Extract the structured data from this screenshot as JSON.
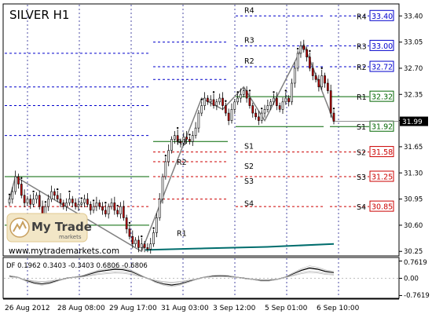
{
  "header": {
    "title": "SILVER H1"
  },
  "watermark": {
    "brand": "My Trade",
    "sub": "markets",
    "url": "www.mytrademarkets.com"
  },
  "colors": {
    "candle_up": "#ffffff",
    "candle_down": "#c00000",
    "wick": "#000000",
    "level_blue": "#0000cc",
    "level_red": "#cc0000",
    "level_green": "#006600",
    "zigzag": "#808080",
    "ma_teal": "#006d6d",
    "current_price_bg": "#000000"
  },
  "chart_data": [
    {
      "type": "candlestick",
      "title": "SILVER H1",
      "x_tick_labels": [
        "26 Aug 2012",
        "28 Aug 08:00",
        "29 Aug 17:00",
        "31 Aug 03:00",
        "3 Sep 12:00",
        "5 Sep 01:00",
        "6 Sep 10:00"
      ],
      "y_tick_labels": [
        "33.40",
        "33.05",
        "32.70",
        "32.35",
        "32.00",
        "31.65",
        "31.30",
        "30.95",
        "30.60",
        "30.25"
      ],
      "ylim": [
        30.2,
        33.55
      ],
      "current_price": "31.99",
      "close_series": [
        30.95,
        31.05,
        31.25,
        31.15,
        31.0,
        30.9,
        30.95,
        30.88,
        30.95,
        31.0,
        30.85,
        30.75,
        30.85,
        30.95,
        31.05,
        31.0,
        30.95,
        30.9,
        30.85,
        30.9,
        30.95,
        30.9,
        30.85,
        30.88,
        30.9,
        30.95,
        30.88,
        30.8,
        30.85,
        30.9,
        30.85,
        30.8,
        30.75,
        30.85,
        30.9,
        30.8,
        30.75,
        30.85,
        30.7,
        30.55,
        30.45,
        30.35,
        30.4,
        30.3,
        30.35,
        30.3,
        30.28,
        30.35,
        30.5,
        30.7,
        30.95,
        31.25,
        31.45,
        31.6,
        31.75,
        31.8,
        31.72,
        31.7,
        31.78,
        31.75,
        31.72,
        31.8,
        31.9,
        32.1,
        32.2,
        32.3,
        32.25,
        32.28,
        32.2,
        32.25,
        32.3,
        32.2,
        32.1,
        32.0,
        32.15,
        32.25,
        32.3,
        32.35,
        32.4,
        32.3,
        32.2,
        32.1,
        32.05,
        32.0,
        32.1,
        32.15,
        32.2,
        32.25,
        32.3,
        32.2,
        32.15,
        32.25,
        32.3,
        32.25,
        32.5,
        32.7,
        32.9,
        33.0,
        32.95,
        32.85,
        32.7,
        32.6,
        32.55,
        32.45,
        32.6,
        32.5,
        32.4,
        32.1,
        31.99
      ],
      "zigzag": [
        [
          0,
          30.95
        ],
        [
          2,
          31.25
        ],
        [
          44,
          30.25
        ],
        [
          64,
          32.3
        ],
        [
          71,
          32.15
        ],
        [
          78,
          32.45
        ],
        [
          85,
          32.0
        ],
        [
          98,
          33.02
        ],
        [
          108,
          31.99
        ]
      ],
      "pivot_levels": [
        {
          "name": "R4",
          "group": "previous",
          "value": 33.4,
          "color": "blue"
        },
        {
          "name": "R3",
          "group": "previous",
          "value": 33.0,
          "color": "blue"
        },
        {
          "name": "R2",
          "group": "previous",
          "value": 32.72,
          "color": "blue"
        },
        {
          "name": "R1",
          "group": "previous",
          "value": 32.32,
          "color": "green"
        },
        {
          "name": "S1",
          "group": "previous",
          "value": 31.92,
          "color": "green"
        },
        {
          "name": "S2",
          "group": "previous",
          "value": 31.58,
          "color": "red"
        },
        {
          "name": "S3",
          "group": "previous",
          "value": 31.25,
          "color": "red"
        },
        {
          "name": "S4",
          "group": "previous",
          "value": 30.85,
          "color": "red"
        }
      ],
      "right_level_labels": [
        {
          "label": "R4",
          "price": "33.40",
          "value": 33.4,
          "color": "blue"
        },
        {
          "label": "R3",
          "price": "33.00",
          "value": 33.0,
          "color": "blue"
        },
        {
          "label": "R2",
          "price": "32.72",
          "value": 32.72,
          "color": "blue"
        },
        {
          "label": "R1",
          "price": "32.32",
          "value": 32.32,
          "color": "green"
        },
        {
          "label": "S1",
          "price": "31.92",
          "value": 31.92,
          "color": "green"
        },
        {
          "label": "S2",
          "price": "31.58",
          "value": 31.58,
          "color": "red"
        },
        {
          "label": "S3",
          "price": "31.25",
          "value": 31.25,
          "color": "red"
        },
        {
          "label": "S4",
          "price": "30.85",
          "value": 30.85,
          "color": "red"
        }
      ],
      "mid_level_labels": [
        {
          "label": "R4",
          "value": 33.4
        },
        {
          "label": "R3",
          "value": 33.0
        },
        {
          "label": "R2",
          "value": 32.72
        },
        {
          "label": "S1",
          "value": 31.72
        },
        {
          "label": "S2",
          "value": 31.45
        },
        {
          "label": "S3",
          "value": 31.25
        },
        {
          "label": "S4",
          "value": 30.95
        }
      ],
      "left_level_labels": [
        {
          "label": "R3",
          "value": 31.72
        },
        {
          "label": "R2",
          "value": 31.45
        },
        {
          "label": "R1",
          "value": 30.5
        }
      ]
    },
    {
      "type": "line",
      "indicator_label": "DF 0.1962 0.3403 -0.3403 0.6806 -0.6806",
      "y_tick_labels": [
        "0.7619",
        "0.00",
        "-0.7619"
      ],
      "ylim": [
        -0.85,
        0.85
      ],
      "series": [
        {
          "values": [
            0.1,
            0.05,
            -0.1,
            -0.2,
            -0.25,
            -0.2,
            -0.1,
            0.0,
            0.05,
            0.1,
            0.2,
            0.3,
            0.35,
            0.4,
            0.38,
            0.3,
            0.15,
            0.0,
            -0.15,
            -0.25,
            -0.3,
            -0.25,
            -0.15,
            -0.05,
            0.05,
            0.1,
            0.12,
            0.1,
            0.05,
            0.0,
            -0.05,
            -0.1,
            -0.1,
            -0.05,
            0.05,
            0.2,
            0.35,
            0.45,
            0.4,
            0.3,
            0.25
          ]
        }
      ]
    }
  ]
}
